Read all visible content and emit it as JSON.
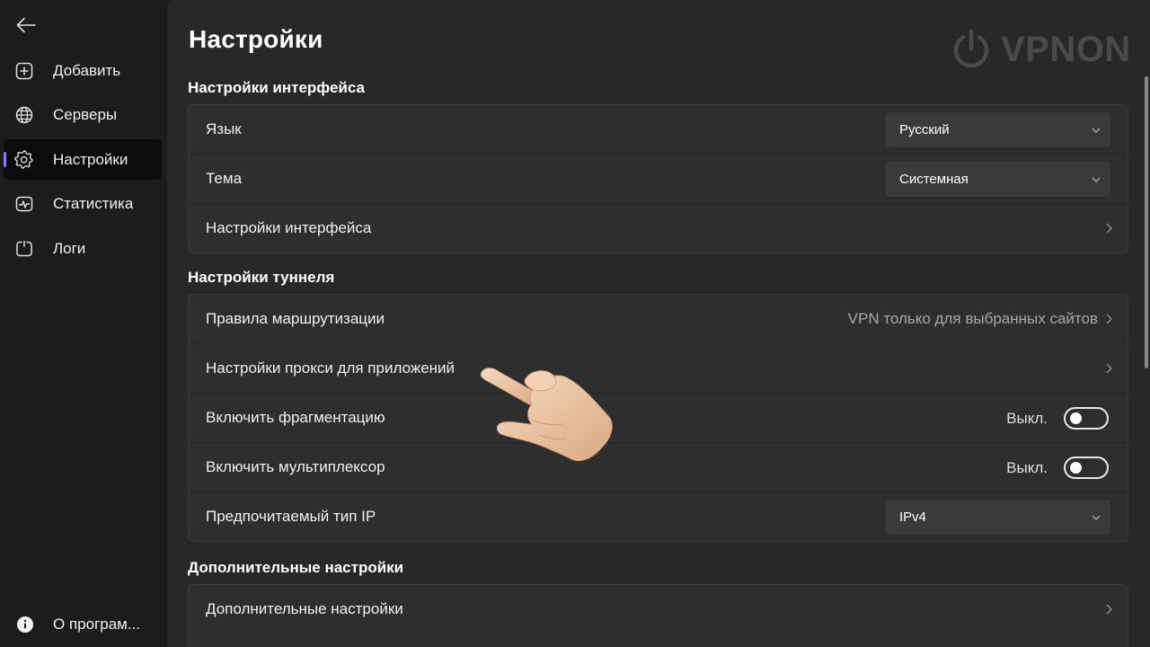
{
  "sidebar": {
    "items": [
      {
        "label": "Добавить",
        "icon": "add-square-icon"
      },
      {
        "label": "Серверы",
        "icon": "globe-icon"
      },
      {
        "label": "Настройки",
        "icon": "gear-icon",
        "active": true
      },
      {
        "label": "Статистика",
        "icon": "chart-icon"
      },
      {
        "label": "Логи",
        "icon": "logs-icon"
      }
    ],
    "about_label": "О програм..."
  },
  "page": {
    "title": "Настройки",
    "logo_text": "VPNON"
  },
  "interface_section": {
    "title": "Настройки интерфейса",
    "language_label": "Язык",
    "language_value": "Русский",
    "theme_label": "Тема",
    "theme_value": "Системная",
    "interface_settings_label": "Настройки интерфейса"
  },
  "tunnel_section": {
    "title": "Настройки туннеля",
    "routing_label": "Правила маршрутизации",
    "routing_value": "VPN только для выбранных сайтов",
    "proxy_label": "Настройки прокси для приложений",
    "fragmentation_label": "Включить фрагментацию",
    "fragmentation_state": "Выкл.",
    "multiplexer_label": "Включить мультиплексор",
    "multiplexer_state": "Выкл.",
    "ip_type_label": "Предпочитаемый тип IP",
    "ip_type_value": "IPv4"
  },
  "advanced_section": {
    "title": "Дополнительные настройки",
    "advanced_label": "Дополнительные настройки"
  },
  "colors": {
    "accent": "#8c7cf0",
    "background": "#282828",
    "card": "#2e2e2e"
  }
}
